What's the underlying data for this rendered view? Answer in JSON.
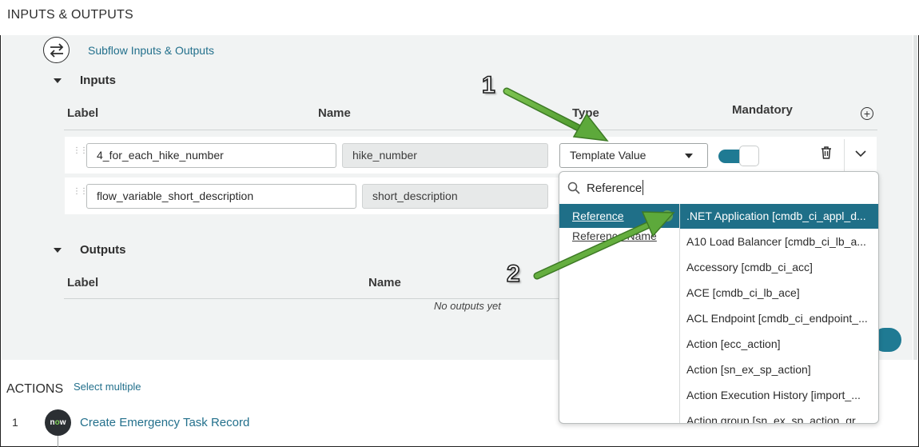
{
  "page": {
    "title": "INPUTS & OUTPUTS"
  },
  "subflow": {
    "link_label": "Subflow Inputs & Outputs",
    "icon": "swap-arrows-icon"
  },
  "inputs": {
    "section_title": "Inputs",
    "columns": {
      "label": "Label",
      "name": "Name",
      "type": "Type",
      "mandatory": "Mandatory"
    },
    "rows": [
      {
        "label": "4_for_each_hike_number",
        "name": "hike_number",
        "type": "Template Value",
        "mandatory": true
      },
      {
        "label": "flow_variable_short_description",
        "name": "short_description"
      }
    ]
  },
  "outputs": {
    "section_title": "Outputs",
    "columns": {
      "label": "Label",
      "name": "Name"
    },
    "empty_text": "No outputs yet"
  },
  "actions": {
    "title": "ACTIONS",
    "select_multiple": "Select multiple",
    "items": [
      {
        "number": "1",
        "logo": "now",
        "label": "Create Emergency Task Record"
      }
    ]
  },
  "dropdown": {
    "search_value": "Reference",
    "categories": [
      "Reference",
      "Reference Name"
    ],
    "options": [
      ".NET Application [cmdb_ci_appl_d...",
      "A10 Load Balancer [cmdb_ci_lb_a...",
      "Accessory [cmdb_ci_acc]",
      "ACE [cmdb_ci_lb_ace]",
      "ACL Endpoint [cmdb_ci_endpoint_...",
      "Action [ecc_action]",
      "Action [sn_ex_sp_action]",
      "Action Execution History [import_...",
      "Action group [sn_ex_sp_action_gr..."
    ]
  },
  "annotations": {
    "step1": "1",
    "step2": "2"
  },
  "colors": {
    "accent": "#1f7a93",
    "link": "#23708c",
    "arrow": "#5da93b",
    "panel": "#f1f3f3"
  }
}
